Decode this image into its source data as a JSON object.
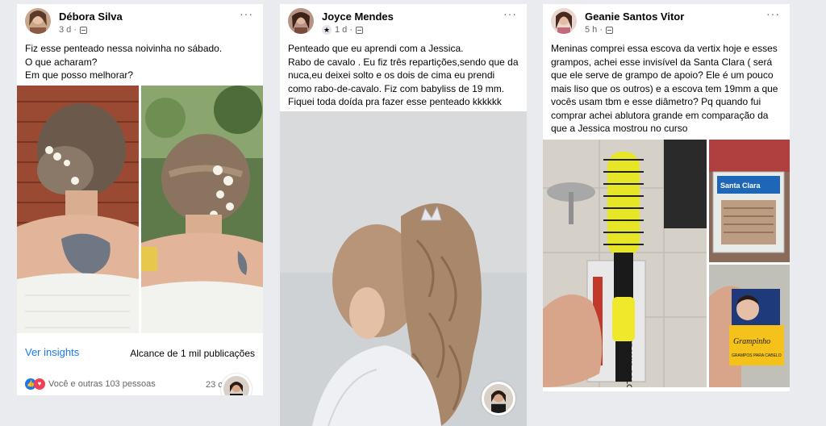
{
  "posts": [
    {
      "author": "Débora Silva",
      "time": "3 d ·",
      "text": "Fiz esse penteado nessa noivinha no sábado.\nO que acharam?\nEm que posso melhorar?",
      "insights_label": "Ver insights",
      "reach_label": "Alcance de 1 mil publicações",
      "reactions_text": "Você e outras 103 pessoas",
      "comments_text": "23 co",
      "more_label": "···"
    },
    {
      "author": "Joyce Mendes",
      "time": "1 d ·",
      "text": "Penteado que eu aprendi com a Jessica.\nRabo de cavalo . Eu fiz três repartições,sendo que da nuca,eu deixei solto e os dois de cima eu prendi como rabo-de-cavalo. Fiz com babyliss de 19 mm. Fiquei toda doída pra fazer esse penteado kkkkkk",
      "more_label": "···"
    },
    {
      "author": "Geanie Santos Vitor",
      "time": "5 h ·",
      "text": "Meninas comprei essa escova da vertix hoje e esses grampos, achei esse invisível da Santa Clara ( será que ele serve de grampo de apoio? Ele é um pouco mais liso que os outros) e a escova tem 19mm a que vocês usam tbm e esse diâmetro? Pq quando fui comprar achei ablutora grande em comparação da que a Jessica mostrou no curso",
      "more_label": "···"
    }
  ],
  "image_texts": {
    "brush_box": "ESCOVA CERAMIC COLOR",
    "clips_brand": "Santa Clara",
    "pins_brand": "Grampinho",
    "pins_label": "GRAMPOS PARA CABELO"
  },
  "icons": {
    "like": "like-icon",
    "love": "love-icon",
    "more": "more-icon",
    "privacy": "globe-icon",
    "star": "star-badge-icon"
  },
  "colors": {
    "link_blue": "#1877f2",
    "meta_gray": "#65676b",
    "background": "#e9ebee"
  }
}
